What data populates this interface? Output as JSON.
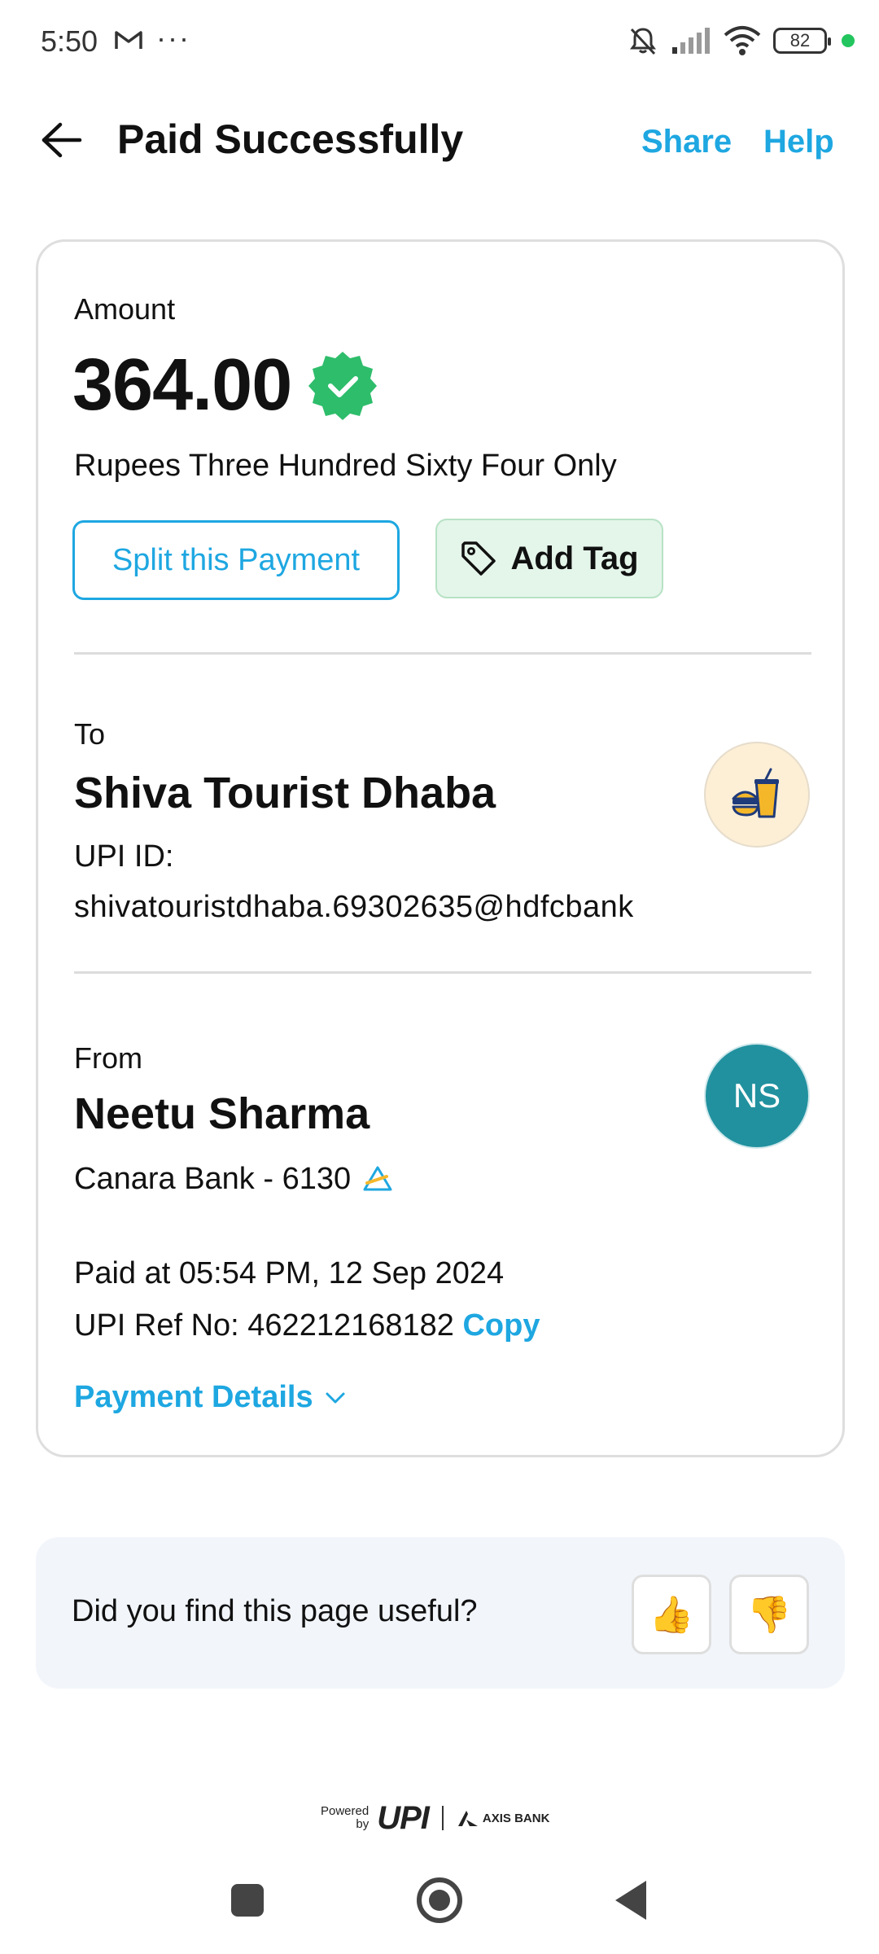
{
  "status_bar": {
    "time": "5:50",
    "dots": "···",
    "battery": "82"
  },
  "header": {
    "title": "Paid Successfully",
    "share_label": "Share",
    "help_label": "Help"
  },
  "payment": {
    "amount_label": "Amount",
    "amount": "364.00",
    "amount_words": "Rupees Three Hundred Sixty Four Only",
    "split_label": "Split this Payment",
    "tag_label": "Add Tag"
  },
  "to": {
    "label": "To",
    "name": "Shiva Tourist Dhaba",
    "upi_label": "UPI ID:",
    "upi_id": "shivatouristdhaba.69302635@hdfcbank"
  },
  "from": {
    "label": "From",
    "name": "Neetu Sharma",
    "initials": "NS",
    "bank": "Canara Bank - 6130"
  },
  "transaction": {
    "paid_at": "Paid at 05:54 PM, 12 Sep 2024",
    "ref_prefix": "UPI Ref No: 462212168182",
    "copy_label": "Copy",
    "details_label": "Payment Details"
  },
  "feedback": {
    "question": "Did you find this page useful?",
    "thumbs_up": "👍",
    "thumbs_down": "👎"
  },
  "footer": {
    "powered_line1": "Powered",
    "powered_line2": "by",
    "upi_logo": "UPI",
    "bank_logo": "AXIS BANK"
  },
  "colors": {
    "accent": "#1ea7e1",
    "verified": "#2ebd6b",
    "avatar": "#21919f",
    "tag_bg": "#e4f5ea"
  }
}
